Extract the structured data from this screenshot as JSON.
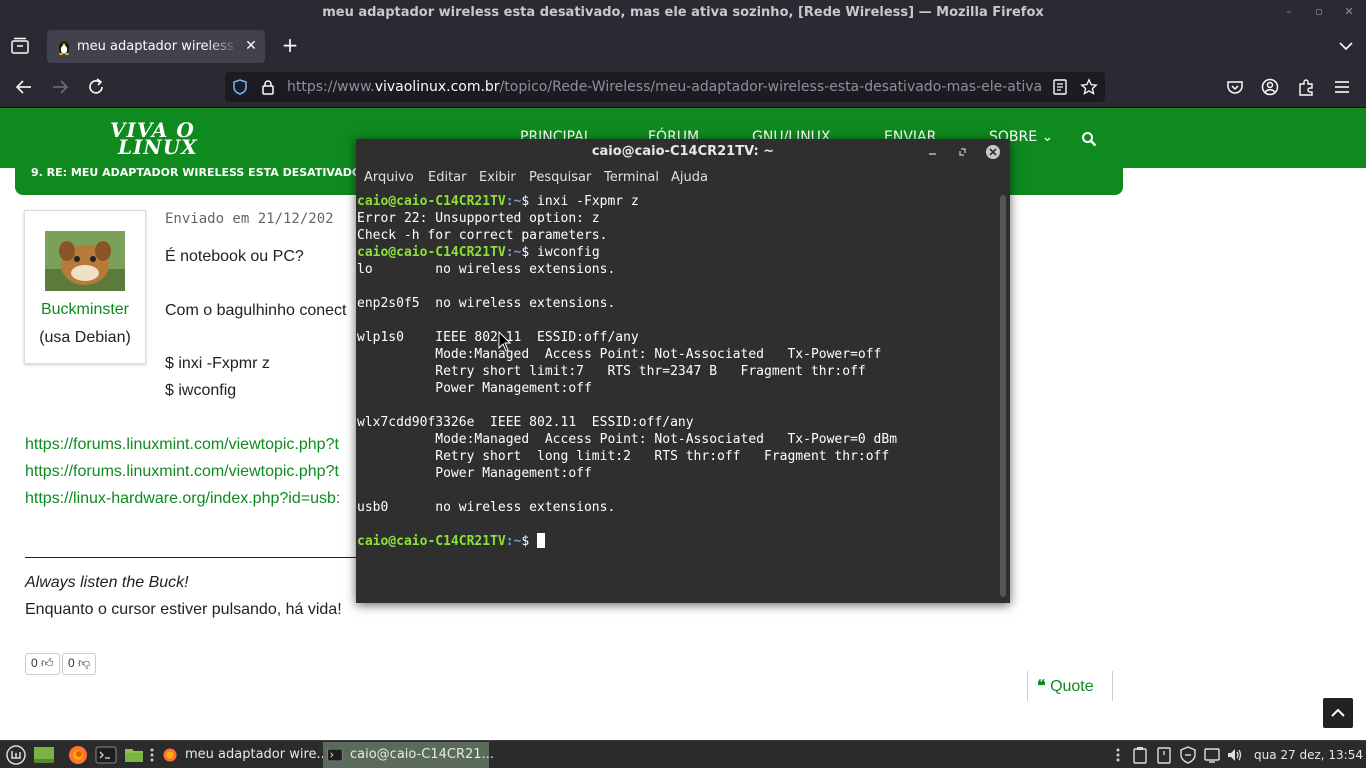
{
  "window": {
    "title": "meu adaptador wireless esta desativado, mas ele ativa sozinho, [Rede Wireless] — Mozilla Firefox"
  },
  "browser": {
    "tab_title": "meu adaptador wireless esta desativado, mas ele ativa sozinho, [Rede Wireless]",
    "url_prefix": "https://www.",
    "url_host": "vivaolinux.com.br",
    "url_path": "/topico/Rede-Wireless/meu-adaptador-wireless-esta-desativado-mas-ele-ativa-sozinho/?p"
  },
  "site": {
    "logo_line1": "VIVA O",
    "logo_line2": "LINUX",
    "nav": [
      "PRINCIPAL",
      "FÓRUM",
      "GNU/LINUX",
      "ENVIAR",
      "SOBRE ⌄"
    ]
  },
  "post": {
    "heading": "9. RE: MEU ADAPTADOR WIRELESS ESTA DESATIVADO, MAS ELE ATIVA SOZINHO",
    "author": "Buckminster",
    "author_distro": "(usa Debian)",
    "sent": "Enviado em 21/12/202",
    "lines": [
      "É notebook ou PC?",
      "Com o bagulhinho conect",
      "$ inxi -Fxpmr z",
      "$ iwconfig"
    ],
    "links": [
      "https://forums.linuxmint.com/viewtopic.php?t",
      "https://forums.linuxmint.com/viewtopic.php?t",
      "https://linux-hardware.org/index.php?id=usb:"
    ],
    "signature_line1": "Always listen the Buck!",
    "signature_line2": "Enquanto o cursor estiver pulsando, há vida!",
    "votes_up": "0",
    "votes_down": "0",
    "quote_label": "Quote"
  },
  "terminal": {
    "title": "caio@caio-C14CR21TV: ~",
    "menu": [
      "Arquivo",
      "Editar",
      "Exibir",
      "Pesquisar",
      "Terminal",
      "Ajuda"
    ],
    "prompt_user": "caio@caio-C14CR21TV",
    "prompt_path": ":~",
    "prompt_symbol": "$ ",
    "lines": [
      {
        "type": "cmd",
        "text": "inxi -Fxpmr z"
      },
      {
        "type": "out",
        "text": "Error 22: Unsupported option: z"
      },
      {
        "type": "out",
        "text": "Check -h for correct parameters."
      },
      {
        "type": "cmd",
        "text": "iwconfig"
      },
      {
        "type": "out",
        "text": "lo        no wireless extensions."
      },
      {
        "type": "out",
        "text": ""
      },
      {
        "type": "out",
        "text": "enp2s0f5  no wireless extensions."
      },
      {
        "type": "out",
        "text": ""
      },
      {
        "type": "out",
        "text": "wlp1s0    IEEE 802.11  ESSID:off/any"
      },
      {
        "type": "out",
        "text": "          Mode:Managed  Access Point: Not-Associated   Tx-Power=off"
      },
      {
        "type": "out",
        "text": "          Retry short limit:7   RTS thr=2347 B   Fragment thr:off"
      },
      {
        "type": "out",
        "text": "          Power Management:off"
      },
      {
        "type": "out",
        "text": ""
      },
      {
        "type": "out",
        "text": "wlx7cdd90f3326e  IEEE 802.11  ESSID:off/any"
      },
      {
        "type": "out",
        "text": "          Mode:Managed  Access Point: Not-Associated   Tx-Power=0 dBm"
      },
      {
        "type": "out",
        "text": "          Retry short  long limit:2   RTS thr:off   Fragment thr:off"
      },
      {
        "type": "out",
        "text": "          Power Management:off"
      },
      {
        "type": "out",
        "text": ""
      },
      {
        "type": "out",
        "text": "usb0      no wireless extensions."
      },
      {
        "type": "out",
        "text": ""
      },
      {
        "type": "prompt",
        "text": ""
      }
    ]
  },
  "taskbar": {
    "tasks": [
      "meu adaptador wire...",
      "caio@caio-C14CR21..."
    ],
    "clock": "qua 27 dez, 13:54"
  },
  "colors": {
    "site_green": "#0f8a1f",
    "prompt_green": "#8ae234",
    "prompt_blue": "#729fcf"
  }
}
